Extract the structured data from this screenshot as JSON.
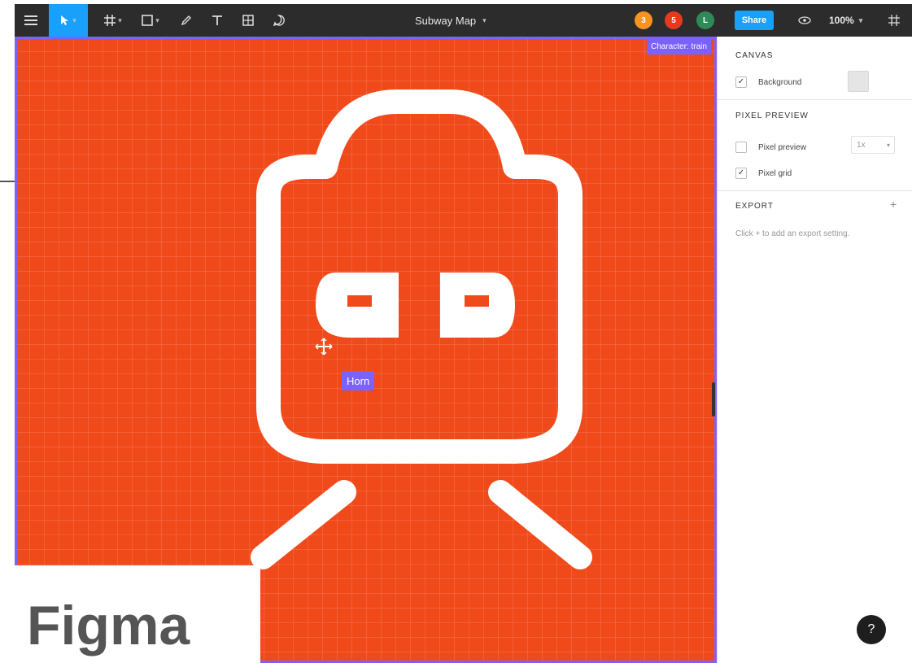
{
  "app": {
    "file_name": "Subway Map",
    "zoom": "100%"
  },
  "toolbar": {
    "share_label": "Share",
    "tools": [
      "menu-icon",
      "move-icon",
      "frame-icon",
      "shape-icon",
      "pen-icon",
      "text-icon",
      "components-icon",
      "comment-icon"
    ]
  },
  "collaborators": [
    {
      "initial": "3",
      "color": "#f7941d"
    },
    {
      "initial": "5",
      "color": "#e8391d"
    },
    {
      "initial": "L",
      "color": "#2e8b57"
    }
  ],
  "canvas": {
    "frame_label": "Character: train",
    "layer_label": "Horn",
    "background": "#f0491a",
    "selection_color": "#7b61ff"
  },
  "panel": {
    "canvas_section": {
      "title": "CANVAS",
      "background_label": "Background",
      "background_checked": true,
      "swatch_color": "#e5e5e5"
    },
    "pixel_preview_section": {
      "title": "PIXEL PREVIEW",
      "pixel_preview_label": "Pixel preview",
      "pixel_preview_checked": false,
      "scale_value": "1x",
      "pixel_grid_label": "Pixel grid",
      "pixel_grid_checked": true
    },
    "export_section": {
      "title": "EXPORT",
      "add_label": "+",
      "hint": "Click + to add an export setting."
    }
  },
  "help_label": "?",
  "overlay": {
    "watermark": "Figma"
  }
}
